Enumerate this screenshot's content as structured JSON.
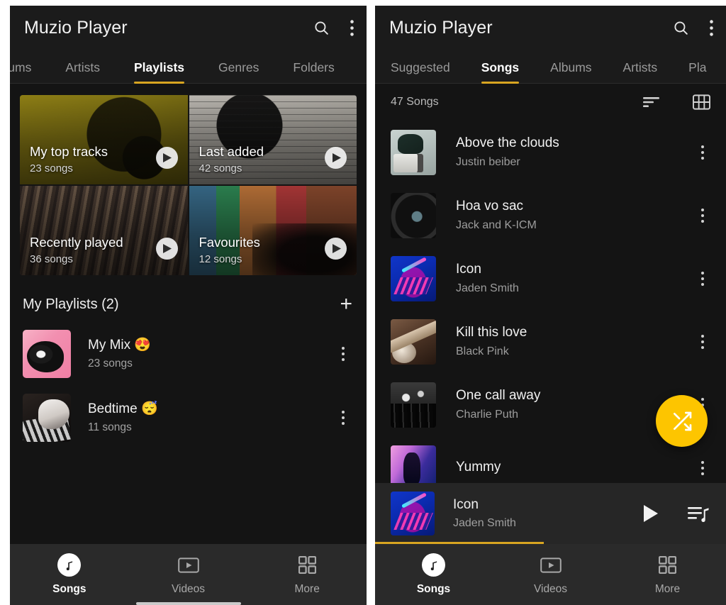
{
  "theme": {
    "accent": "#d8a521",
    "fab": "#fdc500",
    "background": "#141414",
    "appbar": "#1b1b1b",
    "nav_background": "#2a2a2a",
    "nowplaying_background": "#262626"
  },
  "left_panel": {
    "appbar": {
      "title": "Muzio Player",
      "search_icon": "search-icon",
      "overflow_icon": "more-vertical-icon"
    },
    "tabs": [
      {
        "label": "Albums",
        "active": false
      },
      {
        "label": "Artists",
        "active": false
      },
      {
        "label": "Playlists",
        "active": true
      },
      {
        "label": "Genres",
        "active": false
      },
      {
        "label": "Folders",
        "active": false
      }
    ],
    "default_playlists": [
      {
        "name": "My top tracks",
        "count": "23 songs",
        "art": "art-toptracks"
      },
      {
        "name": "Last added",
        "count": "42 songs",
        "art": "art-lastadded"
      },
      {
        "name": "Recently played",
        "count": "36 songs",
        "art": "art-recent"
      },
      {
        "name": "Favourites",
        "count": "12 songs",
        "art": "art-fav"
      }
    ],
    "my_playlists": {
      "title": "My Playlists (2)",
      "add_label": "+",
      "items": [
        {
          "name": "My Mix 😍",
          "count": "23 songs",
          "thumb": "th-mymix"
        },
        {
          "name": "Bedtime 😴",
          "count": "11 songs",
          "thumb": "th-bed"
        }
      ]
    },
    "bottom_nav": [
      {
        "label": "Songs",
        "icon": "music-note-icon",
        "active": true
      },
      {
        "label": "Videos",
        "icon": "video-icon",
        "active": false
      },
      {
        "label": "More",
        "icon": "grid-icon",
        "active": false
      }
    ]
  },
  "right_panel": {
    "appbar": {
      "title": "Muzio Player",
      "search_icon": "search-icon",
      "overflow_icon": "more-vertical-icon"
    },
    "tabs": [
      {
        "label": "Suggested",
        "active": false
      },
      {
        "label": "Songs",
        "active": true
      },
      {
        "label": "Albums",
        "active": false
      },
      {
        "label": "Artists",
        "active": false
      },
      {
        "label": "Pla",
        "active": false
      }
    ],
    "list_header": {
      "count": "47 Songs",
      "sort_icon": "sort-icon",
      "grid_icon": "grid-view-icon"
    },
    "songs": [
      {
        "title": "Above the clouds",
        "artist": "Justin beiber",
        "cover": "cv1"
      },
      {
        "title": "Hoa vo sac",
        "artist": "Jack and K-ICM",
        "cover": "cv2"
      },
      {
        "title": "Icon",
        "artist": "Jaden Smith",
        "cover": "cv3"
      },
      {
        "title": "Kill this love",
        "artist": "Black Pink",
        "cover": "cv4"
      },
      {
        "title": "One call away",
        "artist": "Charlie Puth",
        "cover": "cv5"
      },
      {
        "title": "Yummy",
        "artist": "",
        "cover": "cv6"
      }
    ],
    "fab": {
      "icon": "shuffle-icon"
    },
    "now_playing": {
      "title": "Icon",
      "artist": "Jaden Smith",
      "cover": "cv3",
      "play_icon": "play-icon",
      "queue_icon": "queue-music-icon",
      "progress_percent": 48
    },
    "bottom_nav": [
      {
        "label": "Songs",
        "icon": "music-note-icon",
        "active": true
      },
      {
        "label": "Videos",
        "icon": "video-icon",
        "active": false
      },
      {
        "label": "More",
        "icon": "grid-icon",
        "active": false
      }
    ]
  }
}
